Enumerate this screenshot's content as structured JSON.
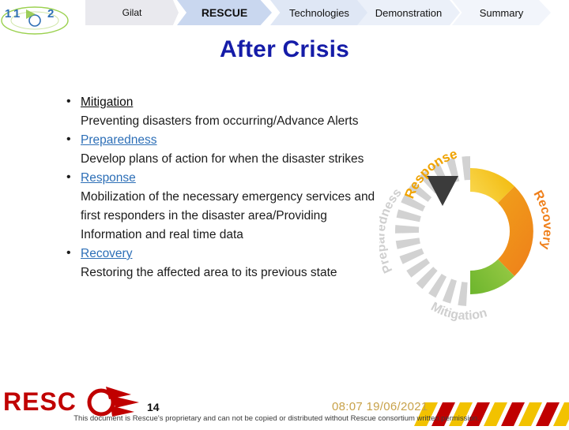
{
  "nav": {
    "items": [
      {
        "label": "Gilat",
        "name": "nav-gilat"
      },
      {
        "label": "RESCUE",
        "name": "nav-rescue"
      },
      {
        "label": "Technologies",
        "name": "nav-technologies"
      },
      {
        "label": "Demonstration",
        "name": "nav-demonstration"
      },
      {
        "label": "Summary",
        "name": "nav-summary"
      }
    ]
  },
  "logo": {
    "alt": "rescue-eye-logo",
    "left_text": "1",
    "right_text": "2"
  },
  "title": "After Crisis",
  "bullets": [
    {
      "term": "Mitigation",
      "text": "Preventing disasters from occurring/Advance Alerts"
    },
    {
      "term": "Preparedness",
      "text": "Develop plans of action for when the disaster strikes"
    },
    {
      "term": "Response",
      "text": "Mobilization of the necessary emergency services and first responders in the disaster area/Providing Information and real time data"
    },
    {
      "term": "Recovery",
      "text": "Restoring the affected area to its previous state"
    }
  ],
  "graphic": {
    "labels": {
      "response": "Response",
      "recovery": "Recovery",
      "preparedness": "Preparedness",
      "mitigation": "Mitigation"
    },
    "colors": {
      "response_yellow": "#f2b705",
      "recovery_orange": "#f08c1b",
      "mitigation_green": "#7ac143",
      "preparedness_grey": "#cfcfcf",
      "arrow": "#3b3b3b"
    }
  },
  "footer": {
    "brand": "RESCUE",
    "slide_number": "14",
    "timestamp": "08:07 19/06/2021",
    "disclaimer": "This document is Rescue's proprietary and can not be copied or distributed without Rescue consortium written permission."
  }
}
